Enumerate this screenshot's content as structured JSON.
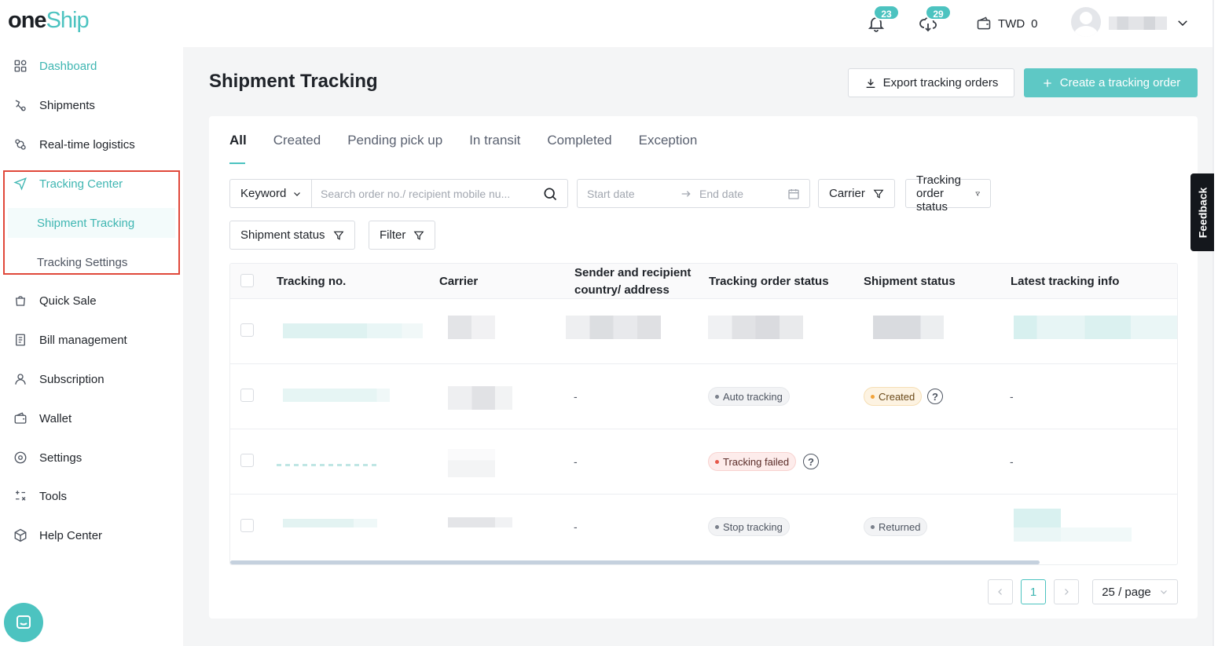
{
  "logo": {
    "one": "one",
    "ship": "Ship"
  },
  "topbar": {
    "notifications_count": "23",
    "downloads_count": "29",
    "currency": "TWD",
    "balance": "0"
  },
  "sidebar": {
    "items": [
      {
        "label": "Dashboard",
        "icon": "dashboard-icon"
      },
      {
        "label": "Shipments",
        "icon": "shipments-icon"
      },
      {
        "label": "Real-time logistics",
        "icon": "logistics-icon"
      },
      {
        "label": "Tracking Center",
        "icon": "tracking-icon"
      },
      {
        "label": "Quick Sale",
        "icon": "quick-sale-icon"
      },
      {
        "label": "Bill management",
        "icon": "bill-icon"
      },
      {
        "label": "Subscription",
        "icon": "user-icon"
      },
      {
        "label": "Wallet",
        "icon": "wallet-icon"
      },
      {
        "label": "Settings",
        "icon": "settings-icon"
      },
      {
        "label": "Tools",
        "icon": "tools-icon"
      },
      {
        "label": "Help Center",
        "icon": "help-box-icon"
      }
    ],
    "sub_items": [
      {
        "label": "Shipment Tracking"
      },
      {
        "label": "Tracking Settings"
      }
    ],
    "accent_color": "#3fb6b2",
    "highlight_color": "#e0483a"
  },
  "main": {
    "title": "Shipment Tracking",
    "export_label": "Export tracking orders",
    "create_label": "Create a tracking order",
    "tabs": [
      "All",
      "Created",
      "Pending pick up",
      "In transit",
      "Completed",
      "Exception"
    ],
    "filters": {
      "keyword_label": "Keyword",
      "search_placeholder": "Search order no./ recipient mobile nu...",
      "start_placeholder": "Start date",
      "end_placeholder": "End date",
      "carrier": "Carrier",
      "tracking_order_status": "Tracking order status",
      "shipment_status": "Shipment status",
      "filter": "Filter"
    },
    "table": {
      "columns": [
        "Tracking no.",
        "Carrier",
        "Sender and recipient country/ address",
        "Tracking order status",
        "Shipment status",
        "Latest tracking info"
      ],
      "rows": [
        {
          "address": "",
          "tracking_status": "",
          "shipment_status": "",
          "latest_info": ""
        },
        {
          "address": "-",
          "tracking_status": "Auto tracking",
          "shipment_status": "Created",
          "latest_info": "-"
        },
        {
          "address": "-",
          "tracking_status": "Tracking failed",
          "shipment_status": "",
          "latest_info": "-"
        },
        {
          "address": "-",
          "tracking_status": "Stop tracking",
          "shipment_status": "Returned",
          "latest_info": ""
        }
      ]
    },
    "pagination": {
      "current_page": "1",
      "page_size": "25 / page"
    }
  },
  "feedback_label": "Feedback"
}
